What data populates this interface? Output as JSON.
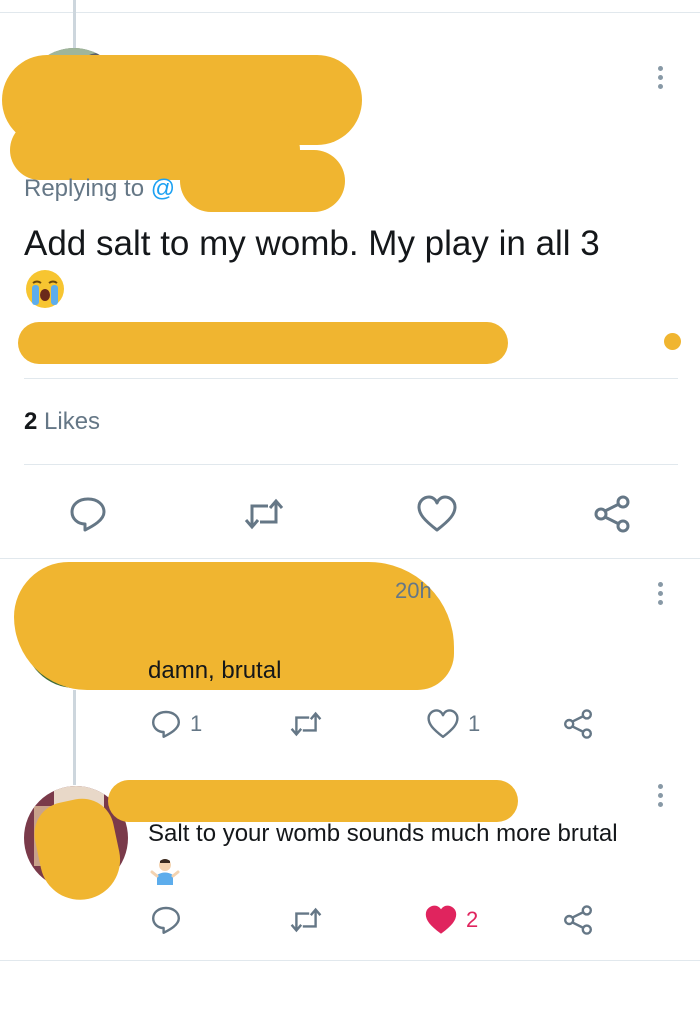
{
  "main_tweet": {
    "replying_label": "Replying to",
    "replying_handle": "@",
    "text": "Add salt to my womb. My play in all 3",
    "emoji": "crying-face",
    "likes_count": "2",
    "likes_label": "Likes"
  },
  "reply1": {
    "time": "20h",
    "text": "damn, brutal",
    "reply_count": "1",
    "like_count": "1"
  },
  "reply2": {
    "text": "Salt to your womb sounds much more brutal",
    "emoji": "man-shrugging",
    "like_count": "2",
    "liked": true
  },
  "colors": {
    "accent": "#1da1f2",
    "icon_gray": "#657786",
    "like_red": "#e0245e",
    "redaction": "#f0b530"
  }
}
